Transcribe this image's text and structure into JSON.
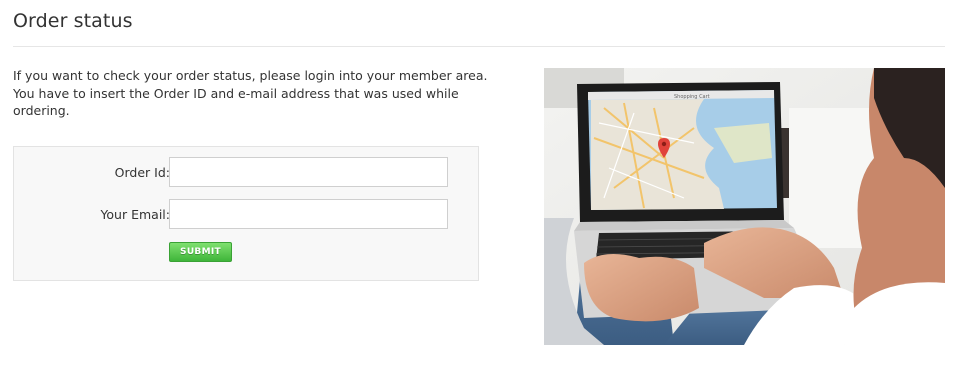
{
  "page": {
    "title": "Order status",
    "intro_lines": [
      "If you want to check your order status, please login into your member area.",
      "You have to insert the Order ID and e-mail address that was used while",
      "ordering."
    ]
  },
  "form": {
    "order_id_label": "Order Id:",
    "order_id_value": "",
    "email_label": "Your Email:",
    "email_value": "",
    "submit_label": "SUBMIT"
  },
  "photo": {
    "screen_header_text": "Shopping Cart",
    "map_marker_icon": "map-pin-icon"
  },
  "colors": {
    "submit_button": "#4cc445",
    "map_marker": "#e0423a",
    "divider": "#e6e6e6",
    "form_background": "#f8f8f8"
  }
}
